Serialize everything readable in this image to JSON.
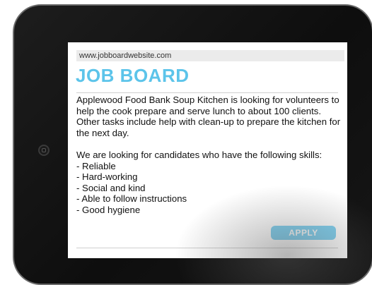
{
  "browser": {
    "url": "www.jobboardwebsite.com"
  },
  "page": {
    "title": "JOB BOARD",
    "description": "Applewood Food Bank Soup Kitchen is looking for volunteers to help the cook prepare and serve lunch to about 100 clients. Other tasks include help with clean-up to prepare the kitchen for the next day.",
    "skills_intro": "We are looking for candidates who have the following skills:",
    "skills": [
      "- Reliable",
      "- Hard-working",
      "- Social and kind",
      "- Able to follow instructions",
      "- Good hygiene"
    ],
    "apply_label": "APPLY"
  },
  "colors": {
    "title": "#5cc4ea",
    "apply_button": "#7fd2f2",
    "device_frame": "#111111"
  }
}
